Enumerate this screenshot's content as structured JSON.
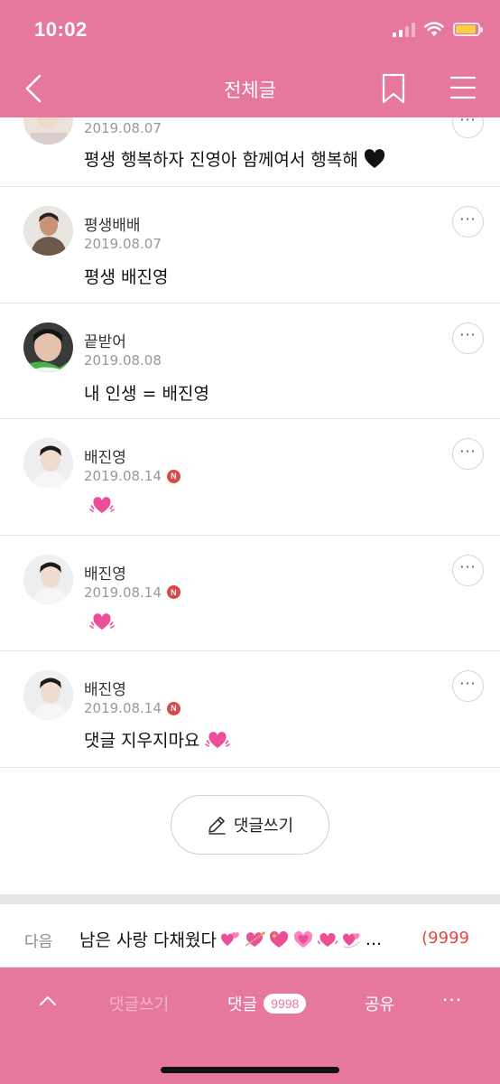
{
  "status_bar": {
    "time": "10:02"
  },
  "nav": {
    "title": "전체글"
  },
  "comments": [
    {
      "date": "2019.08.07",
      "text": "평생 행복하자 진영아 함께여서 행복해",
      "emoji": "black-heart"
    },
    {
      "name": "평생배배",
      "date": "2019.08.07",
      "text": "평생 배진영"
    },
    {
      "name": "끝받어",
      "date": "2019.08.08",
      "text": "내 인생 = 배진영"
    },
    {
      "name": "배진영",
      "date": "2019.08.14",
      "badge": "N",
      "text": "",
      "emoji": "vibrating-heart"
    },
    {
      "name": "배진영",
      "date": "2019.08.14",
      "badge": "N",
      "text": "",
      "emoji": "vibrating-heart"
    },
    {
      "name": "배진영",
      "date": "2019.08.14",
      "badge": "N",
      "text": "댓글 지우지마요",
      "emoji": "vibrating-heart"
    }
  ],
  "more_label": "···",
  "write_button": {
    "label": "댓글쓰기"
  },
  "next_post": {
    "label": "다음",
    "title": "남은 사랑 다채웠다",
    "ellipsis": "...",
    "count": "(9999"
  },
  "bottom_bar": {
    "write_label": "댓글쓰기",
    "comment_label": "댓글",
    "comment_count": "9998",
    "share_label": "공유",
    "more_label": "···"
  },
  "colors": {
    "brand_pink": "#e6789f",
    "badge_red": "#e04646",
    "heart_pink": "#ec4f97"
  }
}
